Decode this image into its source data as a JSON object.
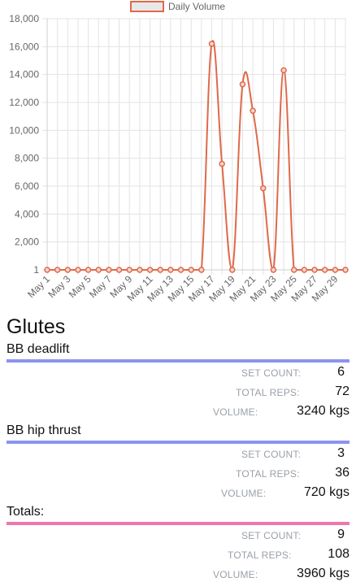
{
  "chart_data": {
    "type": "line",
    "legend": [
      "Daily Volume"
    ],
    "legend_position": "top",
    "series": [
      {
        "name": "Daily Volume",
        "color": "#e0694a",
        "values": [
          1,
          1,
          1,
          1,
          1,
          1,
          1,
          1,
          1,
          1,
          1,
          1,
          1,
          1,
          1,
          1,
          16200,
          7600,
          1,
          13300,
          11400,
          5850,
          1,
          14300,
          1,
          1,
          1,
          1,
          1,
          1
        ]
      }
    ],
    "x": [
      "May 1",
      "May 2",
      "May 3",
      "May 4",
      "May 5",
      "May 6",
      "May 7",
      "May 8",
      "May 9",
      "May 10",
      "May 11",
      "May 12",
      "May 13",
      "May 14",
      "May 15",
      "May 16",
      "May 17",
      "May 18",
      "May 19",
      "May 20",
      "May 21",
      "May 22",
      "May 23",
      "May 24",
      "May 25",
      "May 26",
      "May 27",
      "May 28",
      "May 29",
      "May 30"
    ],
    "x_tick_labels": [
      "May 1",
      "May 3",
      "May 5",
      "May 7",
      "May 9",
      "May 11",
      "May 13",
      "May 15",
      "May 17",
      "May 19",
      "May 21",
      "May 23",
      "May 25",
      "May 27",
      "May 29"
    ],
    "y_ticks": [
      1,
      2000,
      4000,
      6000,
      8000,
      10000,
      12000,
      14000,
      16000,
      18000
    ],
    "y_tick_labels": [
      "1",
      "2,000",
      "4,000",
      "6,000",
      "8,000",
      "10,000",
      "12,000",
      "14,000",
      "16,000",
      "18,000"
    ],
    "ylim": [
      1,
      18000
    ],
    "grid": true
  },
  "section_title": "Glutes",
  "exercises": [
    {
      "name": "BB deadlift",
      "set_count_label": "SET COUNT:",
      "set_count": "6",
      "total_reps_label": "TOTAL REPS:",
      "total_reps": "72",
      "volume_label": "VOLUME:",
      "volume": "3240 kgs"
    },
    {
      "name": "BB hip thrust",
      "set_count_label": "SET COUNT:",
      "set_count": "3",
      "total_reps_label": "TOTAL REPS:",
      "total_reps": "36",
      "volume_label": "VOLUME:",
      "volume": "720 kgs"
    }
  ],
  "totals": {
    "name": "Totals:",
    "set_count_label": "SET COUNT:",
    "set_count": "9",
    "total_reps_label": "TOTAL REPS:",
    "total_reps": "108",
    "volume_label": "VOLUME:",
    "volume": "3960 kgs"
  },
  "colors": {
    "exercise_bar": "#8c93f0",
    "totals_bar": "#ec78ad",
    "line": "#e0694a"
  }
}
